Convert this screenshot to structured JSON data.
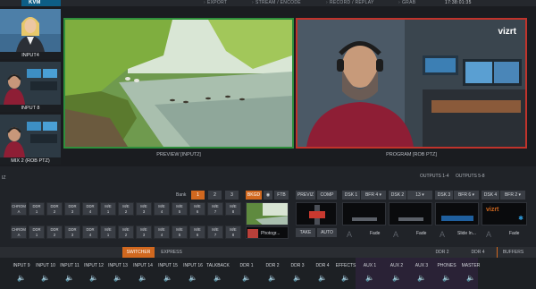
{
  "app": {
    "logo": "KVM"
  },
  "menu": {
    "export": "EXPORT",
    "stream": "STREAM / ENCODE",
    "record": "RECORD / REPLAY",
    "grab": "GRAB",
    "clock": "17:38:01:35"
  },
  "brand": {
    "watermark": "vizrt"
  },
  "inputs": [
    {
      "label": "INPUT4"
    },
    {
      "label": "INPUT 8"
    },
    {
      "label": "MIX 2 (ROB PTZ)"
    }
  ],
  "monitors": {
    "preview_label": "PREVIEW [INPUT2]",
    "program_label": "PROGRAM [ROB PTZ]"
  },
  "switcher": {
    "row_label": "IZ",
    "outputs_a": "OUTPUTS 1-4",
    "outputs_b": "OUTPUTS 5-8",
    "bank_label": "Bank",
    "banks": [
      "1",
      "2",
      "3"
    ],
    "active_bank": "1",
    "bkgd": "BKGD",
    "ftb": "FTB",
    "previz": "PREVIZ",
    "comp": "COMP",
    "dsk1": "DSK 1",
    "dsk1_src": "BFR 4",
    "dsk2": "DSK 2",
    "dsk2_src": "13",
    "dsk3": "DSK 3",
    "dsk3_src": "BFR 6",
    "dsk4": "DSK 4",
    "dsk4_src": "BFR 2",
    "take": "TAKE",
    "auto": "AUTO",
    "fade": "Fade",
    "slide_in": "Slide In...",
    "photo_label": "Photogr...",
    "program_bus": [
      [
        "CHROM",
        "A"
      ],
      [
        "DDR",
        "1"
      ],
      [
        "DDR",
        "2"
      ],
      [
        "DDR",
        "3"
      ],
      [
        "DDR",
        "4"
      ],
      [
        "M/E",
        "1"
      ],
      [
        "M/E",
        "2"
      ],
      [
        "M/E",
        "3"
      ],
      [
        "M/E",
        "4"
      ],
      [
        "M/E",
        "5"
      ],
      [
        "M/E",
        "6"
      ],
      [
        "M/E",
        "7"
      ],
      [
        "M/E",
        "8"
      ]
    ],
    "preview_bus": [
      [
        "CHROM",
        "A"
      ],
      [
        "DDR",
        "1"
      ],
      [
        "DDR",
        "2"
      ],
      [
        "DDR",
        "3"
      ],
      [
        "DDR",
        "4"
      ],
      [
        "M/E",
        "1"
      ],
      [
        "M/E",
        "2"
      ],
      [
        "M/E",
        "3"
      ],
      [
        "M/E",
        "4"
      ],
      [
        "M/E",
        "5"
      ],
      [
        "M/E",
        "6"
      ],
      [
        "M/E",
        "7"
      ],
      [
        "M/E",
        "8"
      ]
    ]
  },
  "tabs": {
    "switcher": "SWITCHER",
    "express": "EXPRESS",
    "ddr2": "DDR 2",
    "ddr4": "DDR 4",
    "buffers": "BUFFERS"
  },
  "audio": {
    "channels": [
      "INPUT 9",
      "INPUT 10",
      "INPUT 11",
      "INPUT 12",
      "INPUT 13",
      "INPUT 14",
      "INPUT 15",
      "INPUT 16",
      "TALKBACK",
      "DDR 1",
      "DDR 2",
      "DDR 3",
      "DDR 4",
      "EFFECTS",
      "AUX 1",
      "AUX 2",
      "AUX 3",
      "PHONES",
      "MASTER"
    ]
  },
  "colors": {
    "accent": "#d1681f",
    "preview": "#2f8f3c",
    "program": "#c0332b",
    "background": "#1a1c20"
  }
}
